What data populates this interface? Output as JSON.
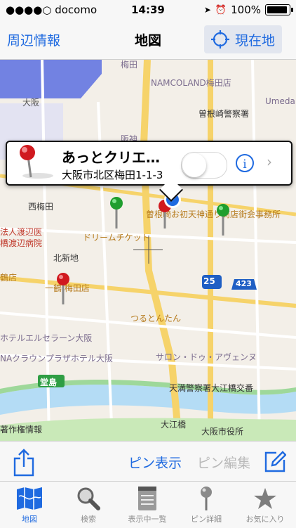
{
  "status": {
    "carrier": "●●●●○ docomo",
    "time": "14:39",
    "battery": "100%",
    "battery_level": 1.0
  },
  "nav": {
    "left": "周辺情報",
    "title": "地図",
    "right": "現在地"
  },
  "map_labels": {
    "umeda_top": "梅田",
    "namcoland": "NAMCOLAND梅田店",
    "umeda_quattro": "Umeda Quattr",
    "osaka": "大阪",
    "sonezaki_police": "曽根崎警察署",
    "hankyu": "阪神",
    "nishi_umeda": "西梅田",
    "houjin": "法人渡辺医",
    "watanabe": "橋渡辺病院",
    "ohatsu": "曽根崎お初天神通り商店街会事務所",
    "dream": "ドリームチケット",
    "kitashinchi": "北新地",
    "umeda_shop": "一鶴 梅田店",
    "kitaten": "鶴店",
    "tsurutontan": "つるとんたん",
    "route25": "25",
    "route423": "423",
    "hotel_elserene": "ホテルエルセラーン大阪",
    "crown_plaza": "NAクラウンプラザホテル大阪",
    "salon": "サロン・ドゥ・アヴェンヌ",
    "dojima": "堂島",
    "tenma_police": "天満警察署大江橋交番",
    "oebashi": "大江橋",
    "city_hall": "大阪市役所",
    "sakushinkan": "著作権情報"
  },
  "callout": {
    "title": "あっとクリエ…",
    "address": "大阪市北区梅田1-1-3",
    "info": "i",
    "chevron": "›"
  },
  "toolbar": {
    "pin_show": "ピン表示",
    "pin_edit": "ピン編集"
  },
  "tabs": [
    {
      "label": "地図",
      "icon": "map-icon",
      "active": true
    },
    {
      "label": "検索",
      "icon": "magnifier-icon",
      "active": false
    },
    {
      "label": "表示中一覧",
      "icon": "notepad-icon",
      "active": false
    },
    {
      "label": "ピン詳細",
      "icon": "pin-icon",
      "active": false
    },
    {
      "label": "お気に入り",
      "icon": "star-icon",
      "active": false
    }
  ],
  "colors": {
    "accent": "#1f6ae0",
    "road_major": "#f6d36a",
    "river": "#b4dcf5",
    "park": "#c9e9b8",
    "pin_red": "#d0191f",
    "pin_green": "#1f9e2e",
    "location_blue": "#1f6ae0"
  }
}
